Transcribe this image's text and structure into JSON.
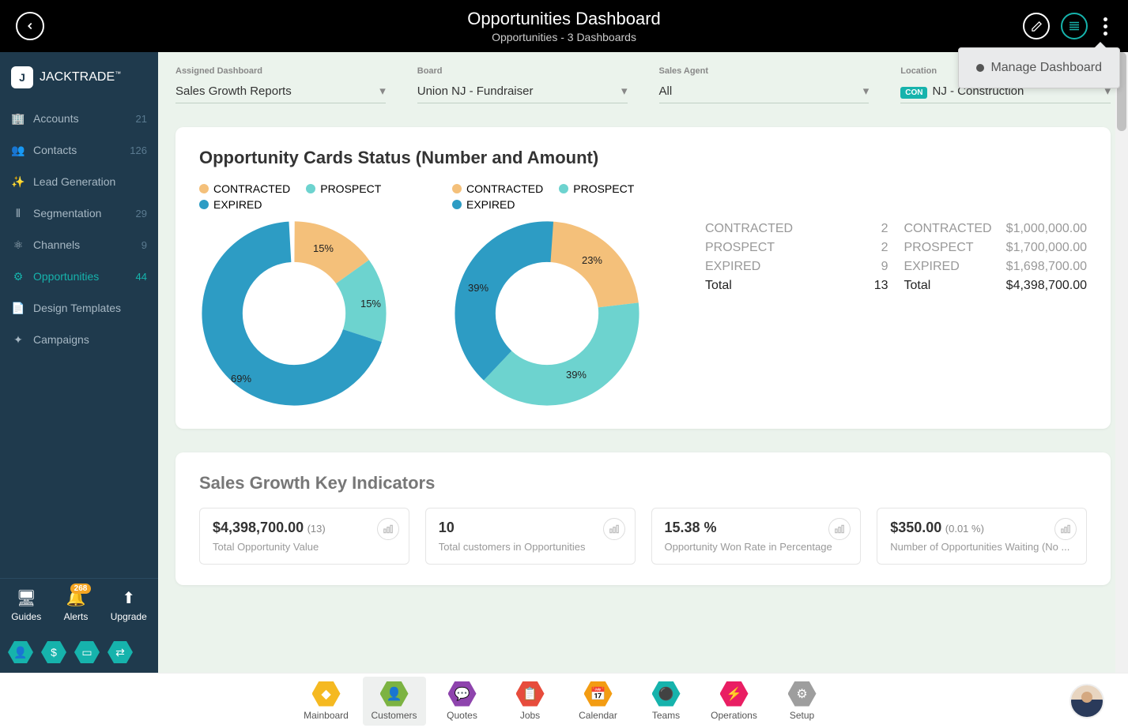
{
  "header": {
    "title": "Opportunities Dashboard",
    "subtitle": "Opportunities - 3 Dashboards"
  },
  "popover": {
    "manage": "Manage Dashboard"
  },
  "logo": {
    "text": "JACKTRADE",
    "tm": "™"
  },
  "sidebar": {
    "items": [
      {
        "label": "Accounts",
        "count": "21",
        "active": false
      },
      {
        "label": "Contacts",
        "count": "126",
        "active": false
      },
      {
        "label": "Lead Generation",
        "count": "",
        "active": false
      },
      {
        "label": "Segmentation",
        "count": "29",
        "active": false
      },
      {
        "label": "Channels",
        "count": "9",
        "active": false
      },
      {
        "label": "Opportunities",
        "count": "44",
        "active": true
      },
      {
        "label": "Design Templates",
        "count": "",
        "active": false
      },
      {
        "label": "Campaigns",
        "count": "",
        "active": false
      }
    ],
    "bottom": {
      "guides": "Guides",
      "alerts": "Alerts",
      "alerts_count": "268",
      "upgrade": "Upgrade"
    }
  },
  "filters": {
    "dashboard": {
      "label": "Assigned Dashboard",
      "value": "Sales Growth Reports"
    },
    "board": {
      "label": "Board",
      "value": "Union NJ - Fundraiser"
    },
    "agent": {
      "label": "Sales Agent",
      "value": "All"
    },
    "location": {
      "label": "Location",
      "badge": "CON",
      "value": "NJ - Construction"
    }
  },
  "card1": {
    "title": "Opportunity Cards Status (Number and Amount)",
    "legend": {
      "contracted": "CONTRACTED",
      "prospect": "PROSPECT",
      "expired": "EXPIRED"
    },
    "stats_count": {
      "contracted_l": "CONTRACTED",
      "contracted_v": "2",
      "prospect_l": "PROSPECT",
      "prospect_v": "2",
      "expired_l": "EXPIRED",
      "expired_v": "9",
      "total_l": "Total",
      "total_v": "13"
    },
    "stats_amount": {
      "contracted_l": "CONTRACTED",
      "contracted_v": "$1,000,000.00",
      "prospect_l": "PROSPECT",
      "prospect_v": "$1,700,000.00",
      "expired_l": "EXPIRED",
      "expired_v": "$1,698,700.00",
      "total_l": "Total",
      "total_v": "$4,398,700.00"
    }
  },
  "chart_data": [
    {
      "type": "pie",
      "title": "Opportunity Cards by Number",
      "series": [
        {
          "name": "CONTRACTED",
          "value": 15,
          "label": "15%"
        },
        {
          "name": "PROSPECT",
          "value": 15,
          "label": "15%"
        },
        {
          "name": "EXPIRED",
          "value": 69,
          "label": "69%"
        }
      ]
    },
    {
      "type": "pie",
      "title": "Opportunity Cards by Amount",
      "series": [
        {
          "name": "CONTRACTED",
          "value": 23,
          "label": "23%"
        },
        {
          "name": "PROSPECT",
          "value": 39,
          "label": "39%"
        },
        {
          "name": "EXPIRED",
          "value": 39,
          "label": "39%"
        }
      ]
    }
  ],
  "card2": {
    "title": "Sales Growth Key Indicators",
    "kpis": [
      {
        "value": "$4,398,700.00",
        "sub": "(13)",
        "desc": "Total Opportunity Value"
      },
      {
        "value": "10",
        "sub": "",
        "desc": "Total customers in Opportunities"
      },
      {
        "value": "15.38 %",
        "sub": "",
        "desc": "Opportunity Won Rate in Percentage"
      },
      {
        "value": "$350.00",
        "sub": "(0.01 %)",
        "desc": "Number of Opportunities Waiting (No ..."
      }
    ]
  },
  "bottomnav": [
    {
      "label": "Mainboard",
      "color": "#f5b921"
    },
    {
      "label": "Customers",
      "color": "#7cb342",
      "active": true
    },
    {
      "label": "Quotes",
      "color": "#8e44ad"
    },
    {
      "label": "Jobs",
      "color": "#e74c3c"
    },
    {
      "label": "Calendar",
      "color": "#f39c12"
    },
    {
      "label": "Teams",
      "color": "#16b3ac"
    },
    {
      "label": "Operations",
      "color": "#e91e63"
    },
    {
      "label": "Setup",
      "color": "#9e9e9e"
    }
  ]
}
